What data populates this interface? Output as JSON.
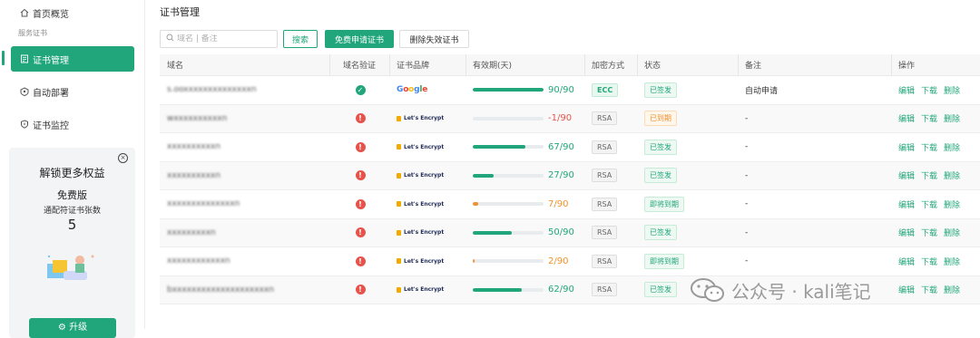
{
  "sidebar": {
    "items": [
      {
        "label": "首页概览",
        "icon": "home-icon"
      },
      {
        "label": "证书管理",
        "icon": "certificate-icon"
      },
      {
        "label": "自动部署",
        "icon": "deploy-icon"
      },
      {
        "label": "证书监控",
        "icon": "shield-icon"
      }
    ],
    "group_label": "服务证书",
    "promo": {
      "title": "解锁更多权益",
      "plan": "免费版",
      "desc": "通配符证书张数",
      "count": "5",
      "upgrade_label": "升级"
    }
  },
  "main": {
    "title": "证书管理",
    "search": {
      "placeholder": "域名 | 备注",
      "value": ""
    },
    "buttons": {
      "search": "搜索",
      "apply": "免费申请证书",
      "delete_invalid": "删除失效证书"
    }
  },
  "table": {
    "headers": [
      "域名",
      "域名验证",
      "证书品牌",
      "有效期(天)",
      "加密方式",
      "状态",
      "备注",
      "操作"
    ],
    "actions": [
      "编辑",
      "下载",
      "删除"
    ],
    "rows": [
      {
        "domain": "s.ooxxxxxxxxxxxxxxn",
        "verified": true,
        "brand": "Google",
        "valid_text": "90/90",
        "valid_fraction": 1.0,
        "algo": "ECC",
        "status": "已签发",
        "status_kind": "issued",
        "remark": "自动申请"
      },
      {
        "domain": "wxxxxxxxxxxn",
        "verified": false,
        "brand": "Let's Encrypt",
        "valid_text": "-1/90",
        "valid_fraction": 0.0,
        "algo": "RSA",
        "status": "已到期",
        "status_kind": "expired",
        "remark": "-"
      },
      {
        "domain": "xxxxxxxxxxn",
        "verified": false,
        "brand": "Let's Encrypt",
        "valid_text": "67/90",
        "valid_fraction": 0.744,
        "algo": "RSA",
        "status": "已签发",
        "status_kind": "issued",
        "remark": "-"
      },
      {
        "domain": "xxxxxxxxxxn",
        "verified": false,
        "brand": "Let's Encrypt",
        "valid_text": "27/90",
        "valid_fraction": 0.3,
        "algo": "RSA",
        "status": "已签发",
        "status_kind": "issued",
        "remark": "-"
      },
      {
        "domain": "xxxxxxxxxxxxxxn",
        "verified": false,
        "brand": "Let's Encrypt",
        "valid_text": "7/90",
        "valid_fraction": 0.078,
        "algo": "RSA",
        "status": "即将到期",
        "status_kind": "soon",
        "remark": "-"
      },
      {
        "domain": "xxxxxxxxxn",
        "verified": false,
        "brand": "Let's Encrypt",
        "valid_text": "50/90",
        "valid_fraction": 0.556,
        "algo": "RSA",
        "status": "已签发",
        "status_kind": "issued",
        "remark": "-"
      },
      {
        "domain": "xxxxxxxxxxxxn",
        "verified": false,
        "brand": "Let's Encrypt",
        "valid_text": "2/90",
        "valid_fraction": 0.022,
        "algo": "RSA",
        "status": "即将到期",
        "status_kind": "soon",
        "remark": "-"
      },
      {
        "domain": "bxxxxxxxxxxxxxxxxxxxxn",
        "verified": false,
        "brand": "Let's Encrypt",
        "valid_text": "62/90",
        "valid_fraction": 0.689,
        "algo": "RSA",
        "status": "已签发",
        "status_kind": "issued",
        "remark": "-"
      }
    ]
  },
  "watermark": {
    "text": "公众号 · kali笔记"
  },
  "colors": {
    "accent": "#20a67a",
    "danger": "#e5534b",
    "warning": "#f0922f"
  }
}
